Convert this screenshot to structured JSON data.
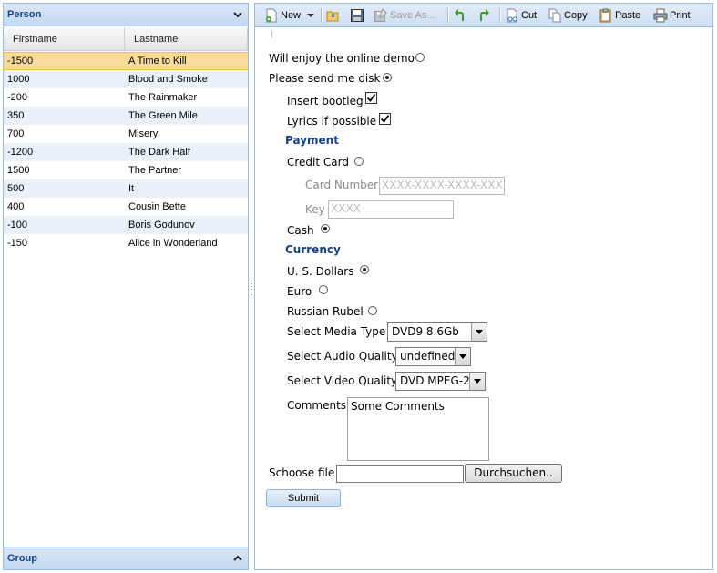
{
  "left": {
    "person_title": "Person",
    "group_title": "Group",
    "columns": [
      "Firstname",
      "Lastname"
    ],
    "rows": [
      {
        "first": "-1500",
        "last": "A Time to Kill"
      },
      {
        "first": "1000",
        "last": "Blood and Smoke"
      },
      {
        "first": "-200",
        "last": "The Rainmaker"
      },
      {
        "first": "350",
        "last": "The Green Mile"
      },
      {
        "first": "700",
        "last": "Misery"
      },
      {
        "first": "-1200",
        "last": "The Dark Half"
      },
      {
        "first": "1500",
        "last": "The Partner"
      },
      {
        "first": "500",
        "last": "It"
      },
      {
        "first": "400",
        "last": "Cousin Bette"
      },
      {
        "first": "-100",
        "last": "Boris Godunov"
      },
      {
        "first": "-150",
        "last": "Alice in Wonderland"
      }
    ],
    "selected_row": 0
  },
  "toolbar": {
    "new": "New",
    "save_as": "Save As...",
    "cut": "Cut",
    "copy": "Copy",
    "paste": "Paste",
    "print": "Print"
  },
  "form": {
    "enjoy_demo": "Will enjoy the online demo",
    "send_disk": "Please send me disk",
    "insert_bootleg": "Insert bootleg",
    "lyrics": "Lyrics if possible",
    "payment": "Payment",
    "credit_card": "Credit Card",
    "card_number_label": "Card Number",
    "card_number_placeholder": "XXXX-XXXX-XXXX-XXXX",
    "key_label": "Key",
    "key_placeholder": "XXXX",
    "cash": "Cash",
    "currency": "Currency",
    "usd": "U. S. Dollars",
    "euro": "Euro",
    "rubel": "Russian Rubel",
    "media_type_label": "Select Media Type",
    "media_type_value": "DVD9 8.6Gb",
    "audio_quality_label": "Select Audio Quality",
    "audio_quality_value": "undefined",
    "video_quality_label": "Select Video Quality",
    "video_quality_value": "DVD MPEG-2",
    "comments_label": "Comments",
    "comments_value": "Some Comments",
    "file_label": "Schoose file",
    "browse": "Durchsuchen..",
    "submit": "Submit"
  }
}
